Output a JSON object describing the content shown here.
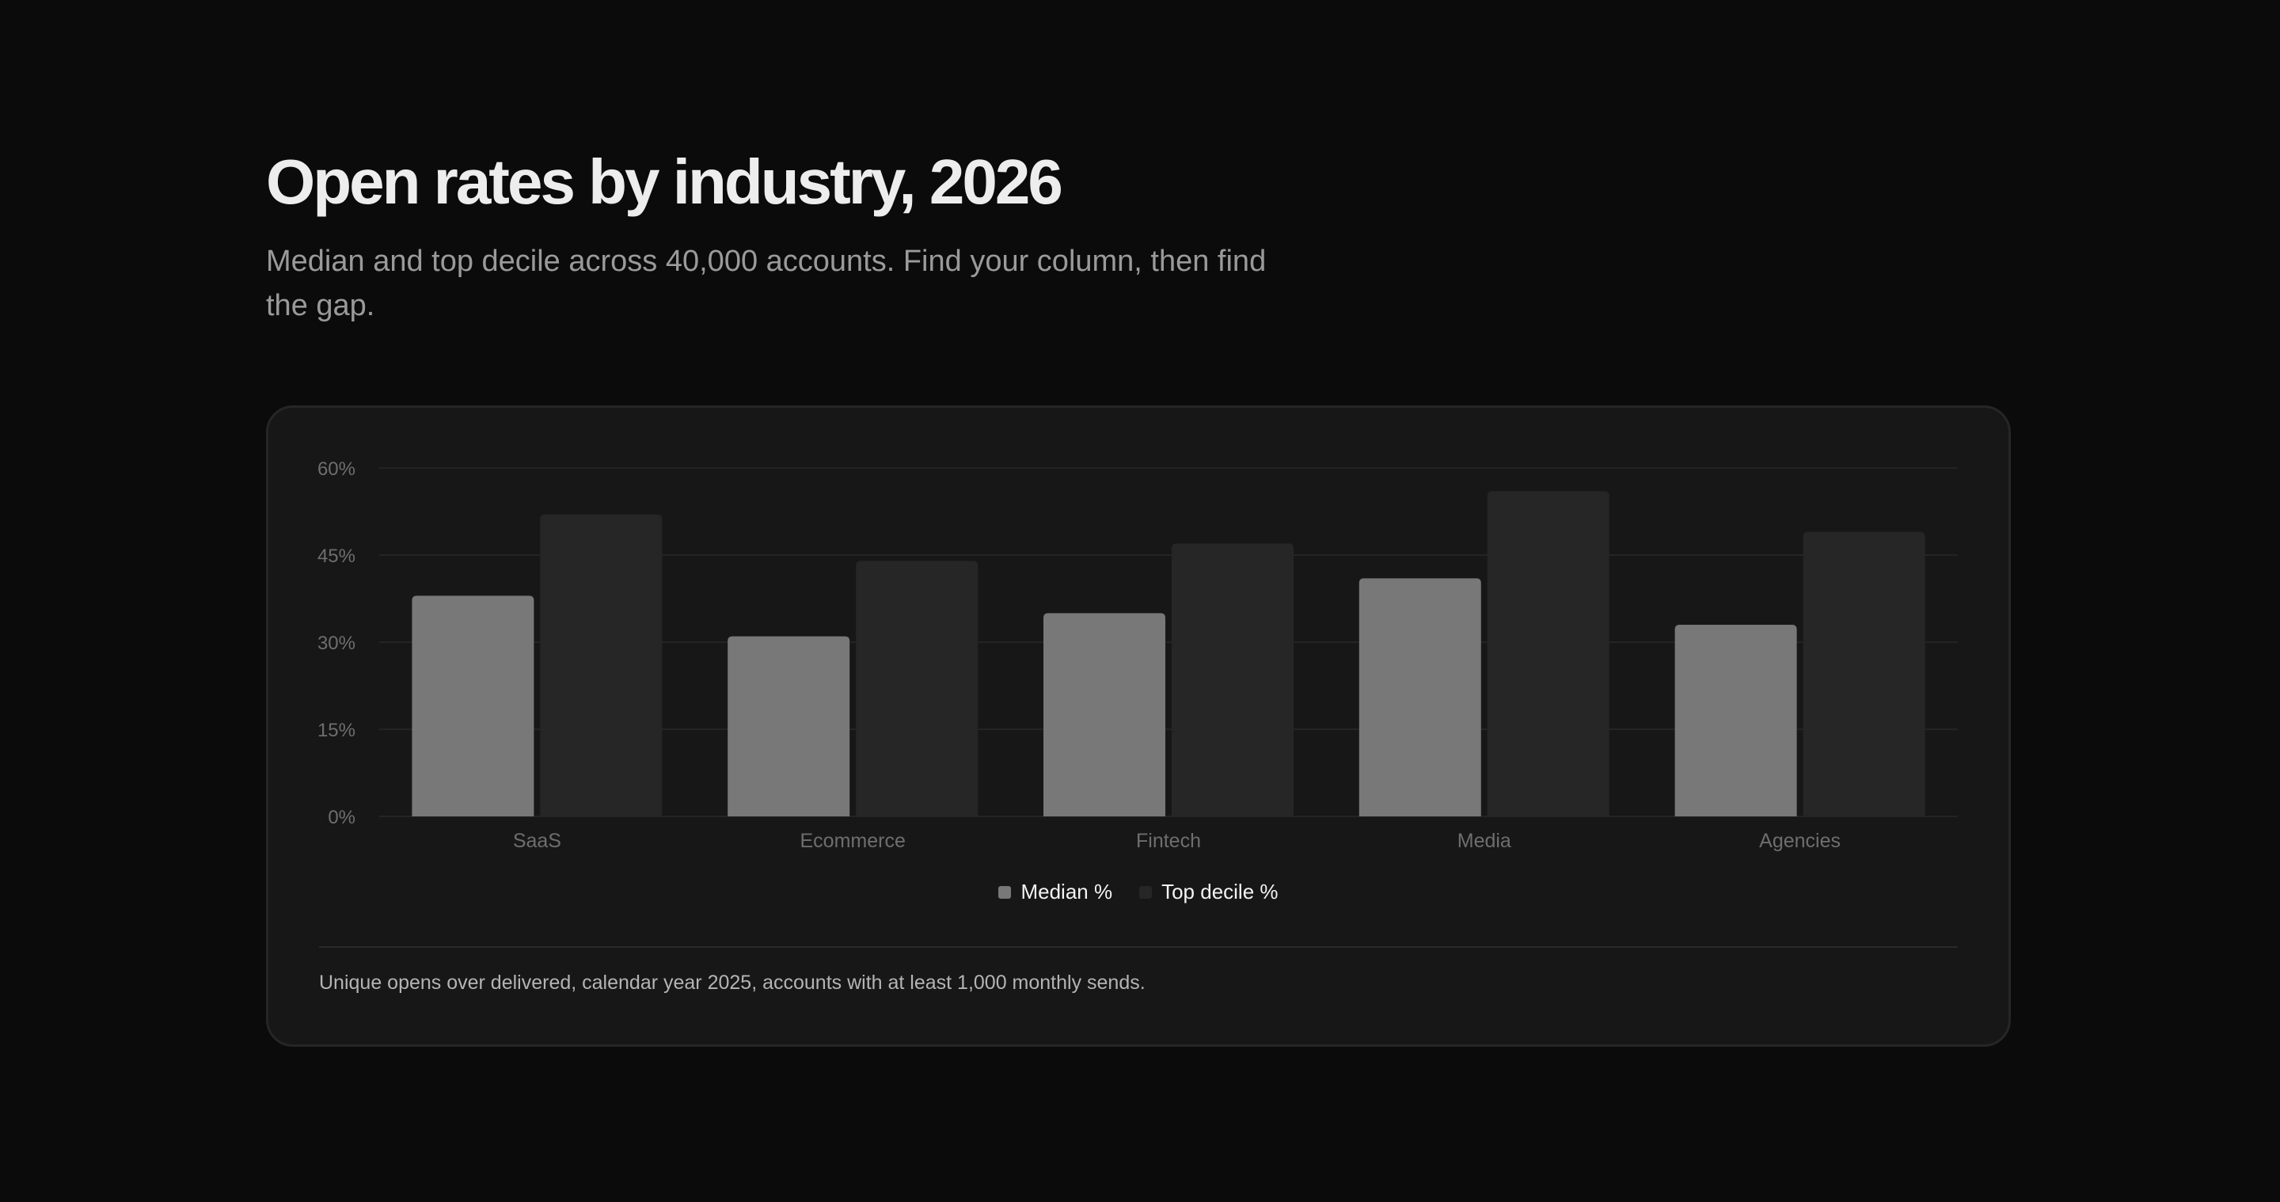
{
  "header": {
    "title": "Open rates by industry, 2026",
    "subtitle": "Median and top decile across 40,000 accounts. Find your column, then find the gap."
  },
  "chart_data": {
    "type": "bar",
    "categories": [
      "SaaS",
      "Ecommerce",
      "Fintech",
      "Media",
      "Agencies"
    ],
    "series": [
      {
        "name": "Median %",
        "values": [
          38,
          31,
          35,
          41,
          33
        ],
        "color": "#787878"
      },
      {
        "name": "Top decile %",
        "values": [
          52,
          44,
          47,
          56,
          49
        ],
        "color": "#262626"
      }
    ],
    "ylim": [
      0,
      60
    ],
    "yticks": [
      0,
      15,
      30,
      45,
      60
    ],
    "ytick_labels": [
      "0%",
      "15%",
      "30%",
      "45%",
      "60%"
    ],
    "grid": true,
    "legend": "bottom-center",
    "xlabel": "",
    "ylabel": ""
  },
  "legend": {
    "median_label": "Median %",
    "top_label": "Top decile %"
  },
  "footnote": "Unique opens over delivered, calendar year 2025, accounts with at least 1,000 monthly sends.",
  "colors": {
    "background": "#0b0b0b",
    "card": "#171717",
    "median_bar": "#787878",
    "top_bar": "#262626",
    "axis_text": "#6e6e6e"
  }
}
